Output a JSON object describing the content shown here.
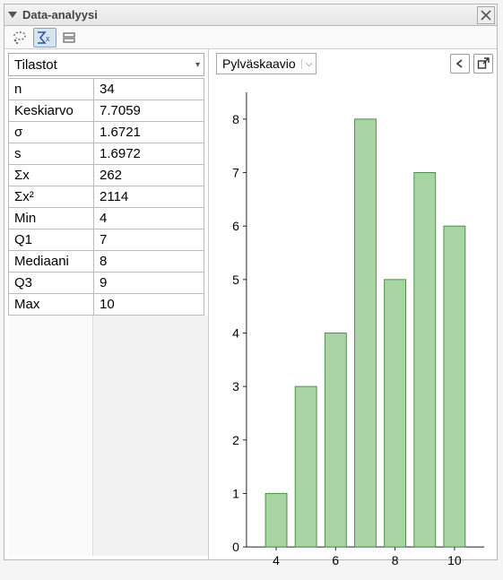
{
  "panel": {
    "title": "Data-analyysi"
  },
  "toolbar": {
    "buttons": [
      {
        "name": "select-tool",
        "active": false
      },
      {
        "name": "sum-tool",
        "active": true
      },
      {
        "name": "stack-tool",
        "active": false
      }
    ]
  },
  "stats": {
    "combo_label": "Tilastot",
    "rows": [
      {
        "label": "n",
        "value": "34"
      },
      {
        "label": "Keskiarvo",
        "value": "7.7059"
      },
      {
        "label": "σ",
        "value": "1.6721"
      },
      {
        "label": "s",
        "value": "1.6972"
      },
      {
        "label": "Σx",
        "value": "262"
      },
      {
        "label": "Σx²",
        "value": "2114"
      },
      {
        "label": "Min",
        "value": "4"
      },
      {
        "label": "Q1",
        "value": "7"
      },
      {
        "label": "Mediaani",
        "value": "8"
      },
      {
        "label": "Q3",
        "value": "9"
      },
      {
        "label": "Max",
        "value": "10"
      }
    ]
  },
  "chart": {
    "combo_label": "Pylväskaavio",
    "y_ticks": [
      0,
      1,
      2,
      3,
      4,
      5,
      6,
      7,
      8
    ],
    "x_ticks": [
      4,
      6,
      8,
      10
    ]
  },
  "chart_data": {
    "type": "bar",
    "title": "",
    "xlabel": "",
    "ylabel": "",
    "categories": [
      4,
      5,
      6,
      7,
      8,
      9,
      10
    ],
    "values": [
      1,
      3,
      4,
      8,
      5,
      7,
      6
    ],
    "ylim": [
      0,
      8.5
    ],
    "xlim": [
      3,
      11
    ]
  }
}
